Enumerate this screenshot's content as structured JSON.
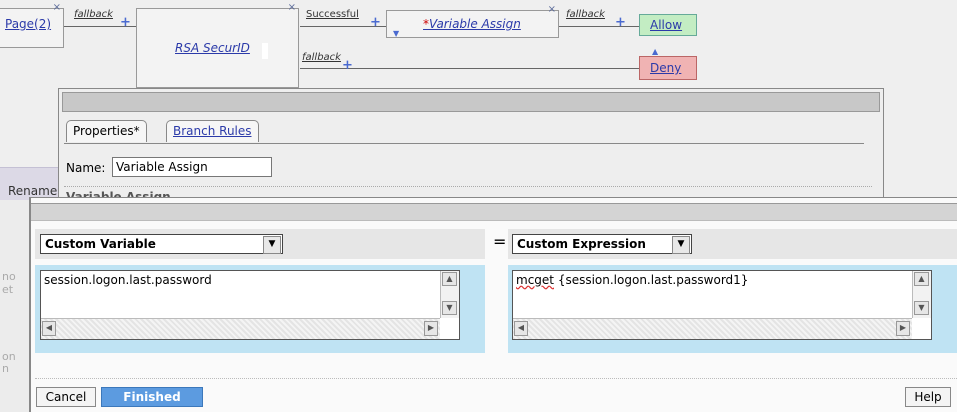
{
  "flow": {
    "page_link": "Page(2)",
    "fallback_1": "fallback",
    "rsa_node": "RSA SecurID",
    "successful_label": "Successful",
    "fallback_2": "fallback",
    "var_assign_node": "Variable Assign",
    "var_assign_star": "*",
    "fallback_3": "fallback",
    "allow": "Allow",
    "deny": "Deny",
    "plus": "+",
    "close": "×"
  },
  "properties": {
    "tabs": [
      {
        "label": "Properties*"
      },
      {
        "label": "Branch Rules"
      }
    ],
    "name_label": "Name:",
    "name_value": "Variable Assign",
    "partial_heading": "Variable Assign",
    "rename_partial": "Rename"
  },
  "dialog": {
    "equals": "=",
    "left": {
      "select_value": "Custom Variable",
      "text": "session.logon.last.password"
    },
    "right": {
      "select_value": "Custom Expression",
      "text_prefix": "mcget",
      "text_rest": " {session.logon.last.password1}"
    },
    "cancel": "Cancel",
    "finished": "Finished",
    "help": "Help"
  },
  "colors": {
    "allow_bg": "#c3edc3",
    "deny_bg": "#f0b3b3",
    "edit_area": "#bfe3f3",
    "primary_button": "#5c9be0"
  }
}
